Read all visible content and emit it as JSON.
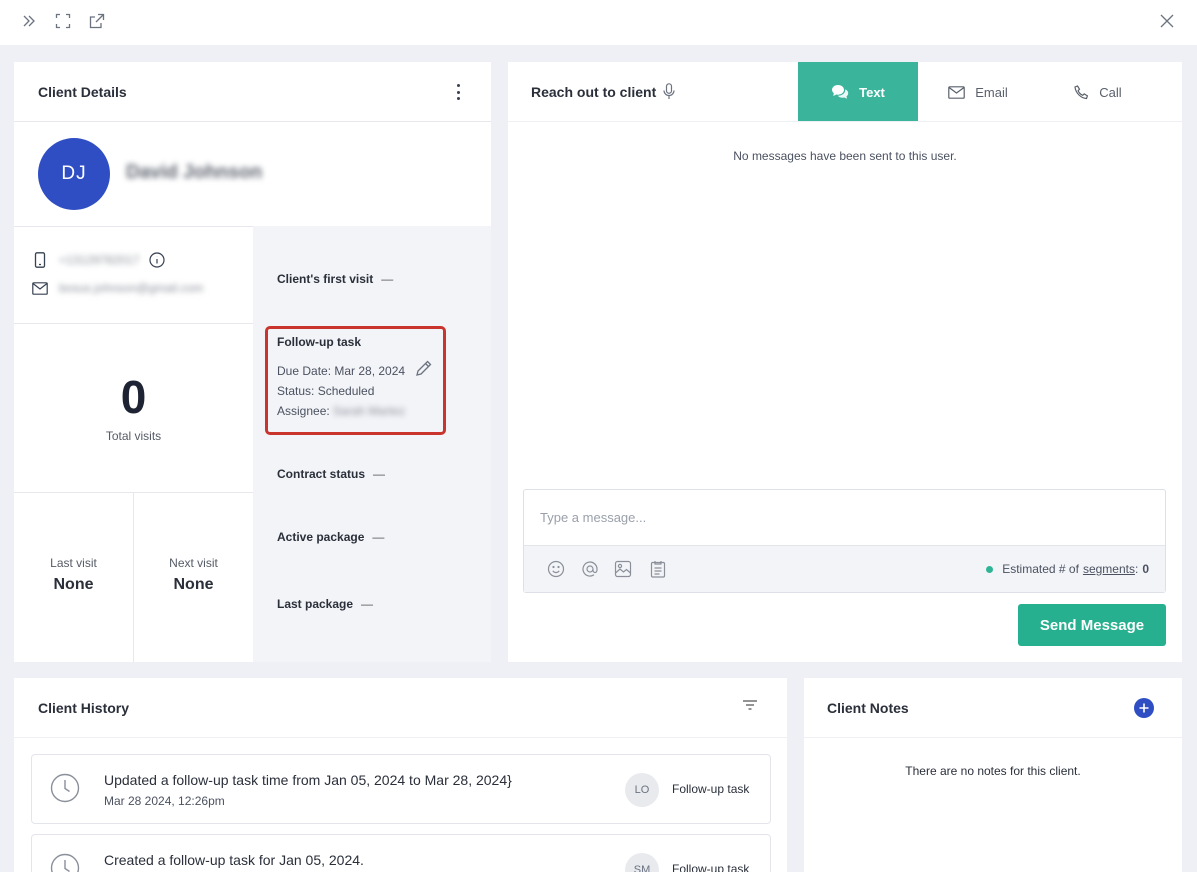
{
  "client_details": {
    "title": "Client Details",
    "avatar_initials": "DJ",
    "name": "David Johnson",
    "phone": "+13129782017",
    "email": "bosus.johnson@gmail.com",
    "total_visits_value": "0",
    "total_visits_label": "Total visits",
    "last_visit_label": "Last visit",
    "last_visit_value": "None",
    "next_visit_label": "Next visit",
    "next_visit_value": "None",
    "first_visit_label": "Client's first visit",
    "first_visit_value": "—",
    "followup": {
      "title": "Follow-up task",
      "due": "Due Date: Mar 28, 2024",
      "status": "Status: Scheduled",
      "assignee_label": "Assignee:",
      "assignee_name": "Sarah Martez"
    },
    "contract_label": "Contract status",
    "contract_value": "—",
    "active_package_label": "Active package",
    "active_package_value": "—",
    "last_package_label": "Last package",
    "last_package_value": "—"
  },
  "reach_out": {
    "title": "Reach out to client",
    "tabs": [
      "Text",
      "Email",
      "Call"
    ],
    "empty_message": "No messages have been sent to this user.",
    "placeholder": "Type a message...",
    "segments_prefix": "Estimated # of",
    "segments_link": "segments",
    "segments_value": "0",
    "send_label": "Send Message"
  },
  "history": {
    "title": "Client History",
    "items": [
      {
        "text": "Updated a follow-up task time from Jan 05, 2024 to Mar 28, 2024}",
        "time": "Mar 28 2024, 12:26pm",
        "initials": "LO",
        "type": "Follow-up task"
      },
      {
        "text": "Created a follow-up task for Jan 05, 2024.",
        "time": "",
        "initials": "SM",
        "type": "Follow-up task"
      }
    ]
  },
  "notes": {
    "title": "Client Notes",
    "empty_message": "There are no notes for this client."
  },
  "colors": {
    "accent_teal": "#3bb49c",
    "send_green": "#27b08f",
    "avatar_blue": "#2f4ec3",
    "highlight_red": "#c9342c"
  }
}
